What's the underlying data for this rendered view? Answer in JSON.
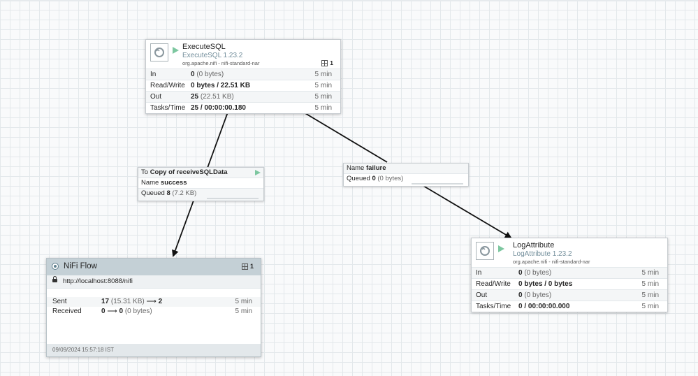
{
  "processors": {
    "execute_sql": {
      "name": "ExecuteSQL",
      "type": "ExecuteSQL 1.23.2",
      "bundle": "org.apache.nifi - nifi-standard-nar",
      "badge": "1",
      "stats": [
        {
          "label": "In",
          "value": "0",
          "sub": "(0 bytes)",
          "time": "5 min"
        },
        {
          "label": "Read/Write",
          "value": "0 bytes / 22.51 KB",
          "sub": "",
          "time": "5 min"
        },
        {
          "label": "Out",
          "value": "25",
          "sub": "(22.51 KB)",
          "time": "5 min"
        },
        {
          "label": "Tasks/Time",
          "value": "25 / 00:00:00.180",
          "sub": "",
          "time": "5 min"
        }
      ]
    },
    "log_attribute": {
      "name": "LogAttribute",
      "type": "LogAttribute 1.23.2",
      "bundle": "org.apache.nifi - nifi-standard-nar",
      "stats": [
        {
          "label": "In",
          "value": "0",
          "sub": "(0 bytes)",
          "time": "5 min"
        },
        {
          "label": "Read/Write",
          "value": "0 bytes / 0 bytes",
          "sub": "",
          "time": "5 min"
        },
        {
          "label": "Out",
          "value": "0",
          "sub": "(0 bytes)",
          "time": "5 min"
        },
        {
          "label": "Tasks/Time",
          "value": "0 / 00:00:00.000",
          "sub": "",
          "time": "5 min"
        }
      ]
    }
  },
  "connections": {
    "success": {
      "to_label": "To",
      "to_value": "Copy of receiveSQLData",
      "name_label": "Name",
      "name_value": "success",
      "queued_label": "Queued",
      "queued_value": "8",
      "queued_sub": "(7.2 KB)"
    },
    "failure": {
      "name_label": "Name",
      "name_value": "failure",
      "queued_label": "Queued",
      "queued_value": "0",
      "queued_sub": "(0 bytes)"
    }
  },
  "remote_group": {
    "title": "NiFi Flow",
    "count": "1",
    "url": "http://localhost:8088/nifi",
    "sent_label": "Sent",
    "sent_value": "17",
    "sent_sub": "(15.31 KB)",
    "sent_arrow": "⟶",
    "sent_ports": "2",
    "sent_time": "5 min",
    "received_label": "Received",
    "received_value": "0",
    "received_arrow": "⟶",
    "received_ports": "0",
    "received_sub": "(0 bytes)",
    "received_time": "5 min",
    "footer_timestamp": "09/09/2024 15:57:18 IST"
  },
  "colors": {
    "running": "#7dc7a0",
    "header_bg": "#c4d0d6",
    "type_text": "#728e9b"
  }
}
